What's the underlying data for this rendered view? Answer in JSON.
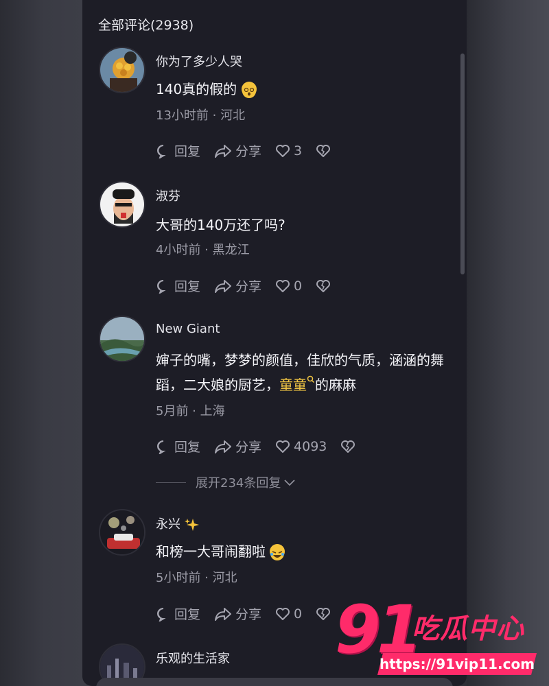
{
  "header": {
    "title": "全部评论(2938)"
  },
  "comments": [
    {
      "name": "你为了多少人哭",
      "text": "140真的假的",
      "meta": "13小时前 · 河北",
      "reply": "回复",
      "share": "分享",
      "likes": "3"
    },
    {
      "name": "淑芬",
      "text": "大哥的140万还了吗?",
      "meta": "4小时前 · 黑龙江",
      "reply": "回复",
      "share": "分享",
      "likes": "0"
    },
    {
      "name": "New Giant",
      "text_part1": "婶子的嘴，梦梦的颜值，佳欣的气质，涵涵的舞蹈，二大娘的厨艺，",
      "keyword": "童童",
      "text_part2": "的麻麻",
      "meta": "5月前 · 上海",
      "reply": "回复",
      "share": "分享",
      "likes": "4093",
      "expand": "展开234条回复"
    },
    {
      "name": "永兴",
      "text": "和榜一大哥闹翻啦",
      "meta": "5小时前 · 河北",
      "reply": "回复",
      "share": "分享",
      "likes": "0"
    },
    {
      "name": "乐观的生活家"
    }
  ],
  "watermark": {
    "number": "91",
    "title": "吃瓜中心",
    "url": "https://91vip11.com"
  },
  "colors": {
    "keyword": "#f3c744",
    "watermark": "#ff2b6a",
    "panel": "#1d1d26"
  }
}
